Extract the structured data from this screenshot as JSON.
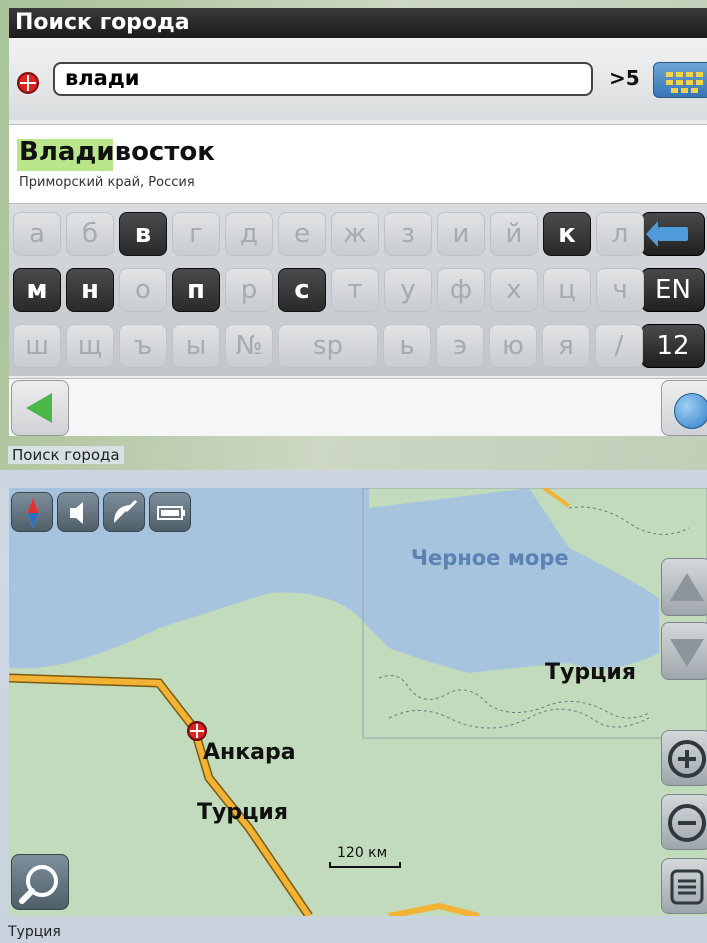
{
  "captions": {
    "top": "Поиск города",
    "bottom": "Турция"
  },
  "search_screen": {
    "title": "Поиск города",
    "input_value": "влади",
    "result_count": ">5",
    "result": {
      "name": "Владивосток",
      "region": "Приморский край, Россия"
    },
    "keyboard": {
      "rows": [
        [
          "а",
          "б",
          "в",
          "г",
          "д",
          "е",
          "ж",
          "з",
          "и",
          "й",
          "к",
          "л"
        ],
        [
          "м",
          "н",
          "о",
          "п",
          "р",
          "с",
          "т",
          "у",
          "ф",
          "х",
          "ц",
          "ч"
        ],
        [
          "ш",
          "щ",
          "ъ",
          "ы",
          "№",
          "sp",
          "ь",
          "э",
          "ю",
          "я",
          "/"
        ]
      ],
      "active_keys": [
        "в",
        "к",
        "м",
        "н",
        "п",
        "с"
      ],
      "lang_label": "EN",
      "num_label": "12"
    }
  },
  "map_screen": {
    "sea_label": "Черное море",
    "labels": {
      "turkey_east": "Турция",
      "ankara": "Анкара",
      "turkey_center": "Турция"
    },
    "scale": "120 км"
  },
  "colors": {
    "title_bar": "#1c1c1c",
    "result_highlight": "#b9e68a",
    "sea": "#a6c4de",
    "land": "#c2dbbc",
    "road": "#f2b233",
    "marker": "#dd2222",
    "back_arrow": "#4cb649"
  }
}
